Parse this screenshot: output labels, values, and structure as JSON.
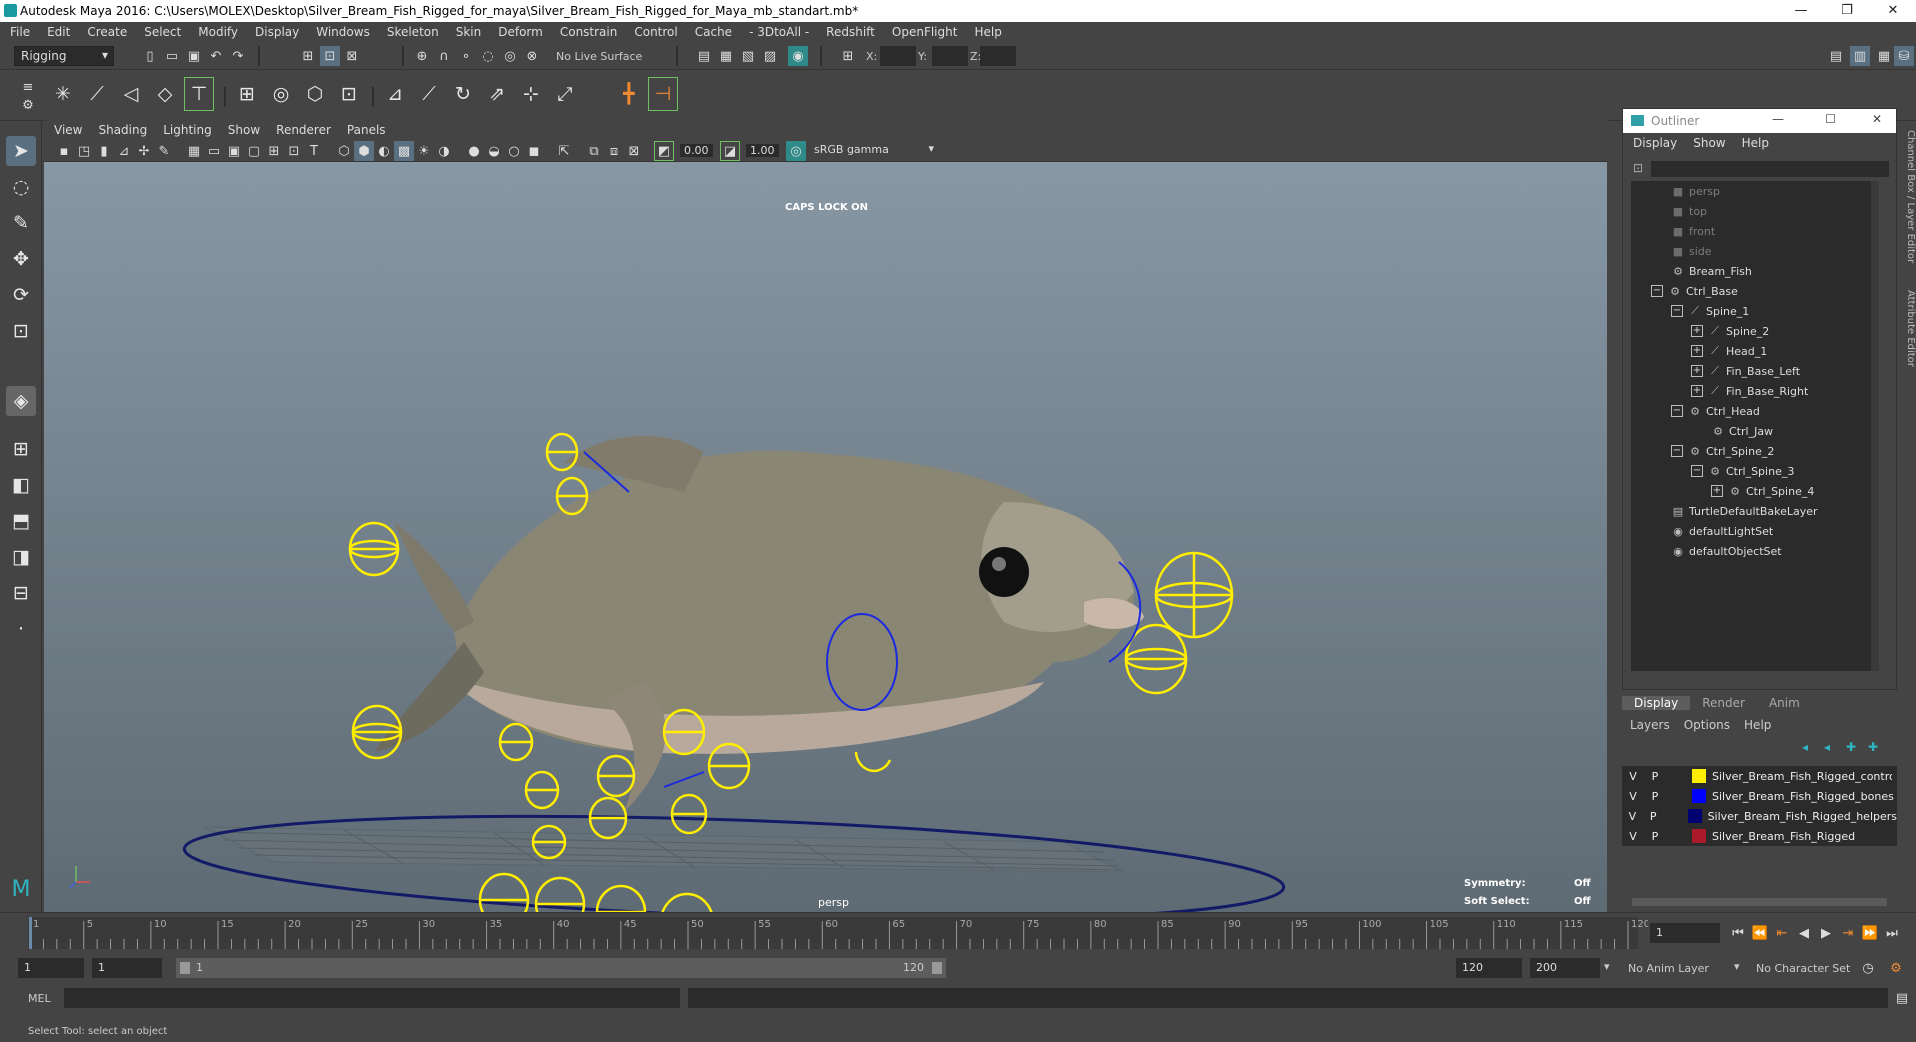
{
  "window": {
    "title": "Autodesk Maya 2016: C:\\Users\\MOLEX\\Desktop\\Silver_Bream_Fish_Rigged_for_maya\\Silver_Bream_Fish_Rigged_for_Maya_mb_standart.mb*",
    "minimize": "—",
    "maximize": "❐",
    "close": "✕"
  },
  "menubar": [
    "File",
    "Edit",
    "Create",
    "Select",
    "Modify",
    "Display",
    "Windows",
    "Skeleton",
    "Skin",
    "Deform",
    "Constrain",
    "Control",
    "Cache",
    "- 3DtoAll -",
    "Redshift",
    "OpenFlight",
    "Help"
  ],
  "status": {
    "menuset": "Rigging",
    "live_surface": "No Live Surface",
    "x_label": "X:",
    "y_label": "Y:",
    "z_label": "Z:"
  },
  "viewport": {
    "menu": [
      "View",
      "Shading",
      "Lighting",
      "Show",
      "Renderer",
      "Panels"
    ],
    "exposure": "0.00",
    "gamma": "1.00",
    "colorspace": "sRGB gamma",
    "caps": "CAPS LOCK ON",
    "camera": "persp",
    "symmetry_label": "Symmetry:",
    "symmetry_value": "Off",
    "softselect_label": "Soft Select:",
    "softselect_value": "Off"
  },
  "outliner": {
    "title": "Outliner",
    "menu": [
      "Display",
      "Show",
      "Help"
    ],
    "items": [
      "persp",
      "top",
      "front",
      "side",
      "Bream_Fish",
      "Ctrl_Base",
      "Spine_1",
      "Spine_2",
      "Head_1",
      "Fin_Base_Left",
      "Fin_Base_Right",
      "Ctrl_Head",
      "Ctrl_Jaw",
      "Ctrl_Spine_2",
      "Ctrl_Spine_3",
      "Ctrl_Spine_4",
      "TurtleDefaultBakeLayer",
      "defaultLightSet",
      "defaultObjectSet"
    ]
  },
  "layers": {
    "tabs": [
      "Display",
      "Render",
      "Anim"
    ],
    "menu": [
      "Layers",
      "Options",
      "Help"
    ],
    "rows": [
      {
        "v": "V",
        "p": "P",
        "color": "#ffee00",
        "name": "Silver_Bream_Fish_Rigged_controllers"
      },
      {
        "v": "V",
        "p": "P",
        "color": "#0000ff",
        "name": "Silver_Bream_Fish_Rigged_bones"
      },
      {
        "v": "V",
        "p": "P",
        "color": "#000070",
        "name": "Silver_Bream_Fish_Rigged_helpers"
      },
      {
        "v": "V",
        "p": "P",
        "color": "#aa1a2a",
        "name": "Silver_Bream_Fish_Rigged"
      }
    ]
  },
  "timeline": {
    "ticks": [
      "1",
      "5",
      "10",
      "15",
      "20",
      "25",
      "30",
      "35",
      "40",
      "45",
      "50",
      "55",
      "60",
      "65",
      "70",
      "75",
      "80",
      "85",
      "90",
      "95",
      "100",
      "105",
      "110",
      "115",
      "120"
    ],
    "current": "1"
  },
  "range": {
    "start": "1",
    "start2": "1",
    "slider_start": "1",
    "slider_end": "120",
    "end": "120",
    "end2": "200",
    "anim_layer": "No Anim Layer",
    "char_set": "No Character Set"
  },
  "cmd": {
    "label": "MEL"
  },
  "help": {
    "text": "Select Tool: select an object"
  },
  "side_tabs": [
    "Channel Box / Layer Editor",
    "Attribute Editor"
  ]
}
